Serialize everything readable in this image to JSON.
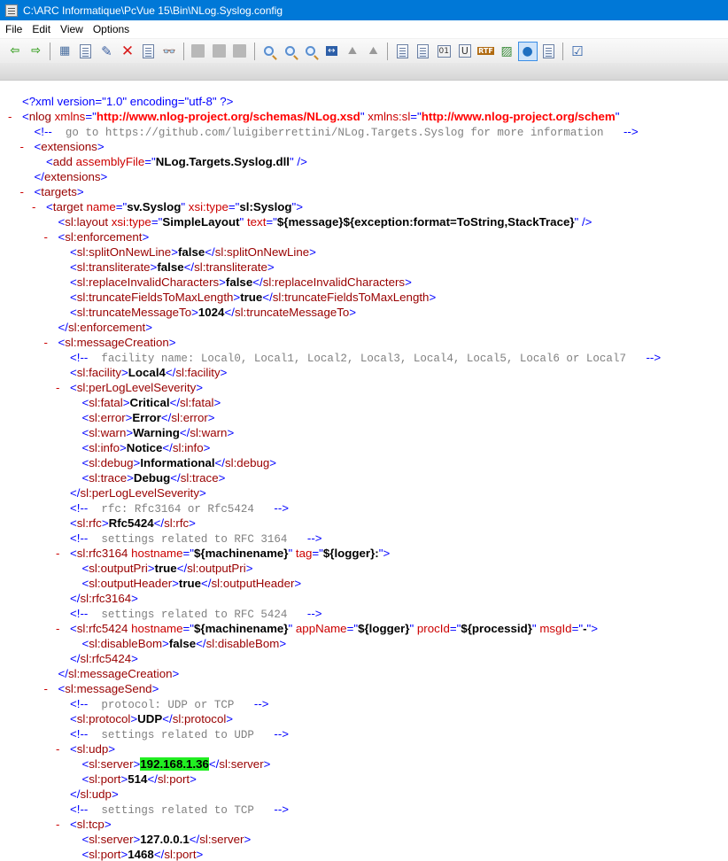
{
  "window": {
    "title": "C:\\ARC Informatique\\PcVue 15\\Bin\\NLog.Syslog.config"
  },
  "menu": [
    "File",
    "Edit",
    "View",
    "Options"
  ],
  "toolbar": {
    "buttons": [
      {
        "name": "back-icon",
        "glyph": "⇦"
      },
      {
        "name": "forward-icon",
        "glyph": "⇨"
      },
      {
        "name": "sep"
      },
      {
        "name": "link-view-icon",
        "glyph": "▦"
      },
      {
        "name": "refresh-icon",
        "glyph": "↻"
      },
      {
        "name": "edit-icon",
        "glyph": "✎"
      },
      {
        "name": "delete-icon",
        "glyph": "✕"
      },
      {
        "name": "validate-icon",
        "glyph": "☑"
      },
      {
        "name": "find-icon",
        "glyph": "🔍"
      },
      {
        "name": "sep"
      },
      {
        "name": "page-icon",
        "glyph": ""
      },
      {
        "name": "page-lines-icon",
        "glyph": ""
      },
      {
        "name": "page-numbered-icon",
        "glyph": ""
      },
      {
        "name": "sep"
      },
      {
        "name": "zoom-in-icon",
        "glyph": ""
      },
      {
        "name": "zoom-out-icon",
        "glyph": ""
      },
      {
        "name": "zoom-icon",
        "glyph": ""
      },
      {
        "name": "fit-width-icon",
        "glyph": "↔"
      },
      {
        "name": "mountain-icon",
        "glyph": "⛰"
      },
      {
        "name": "mountain-alt-icon",
        "glyph": "⛰"
      },
      {
        "name": "sep"
      },
      {
        "name": "text-view-icon",
        "glyph": ""
      },
      {
        "name": "list-view-icon",
        "glyph": ""
      },
      {
        "name": "binary-view-icon",
        "glyph": "01"
      },
      {
        "name": "unicode-view-icon",
        "glyph": "U"
      },
      {
        "name": "rtf-view-icon",
        "glyph": "RTF"
      },
      {
        "name": "image-view-icon",
        "glyph": "▨"
      },
      {
        "name": "web-view-icon",
        "glyph": "●",
        "active": true
      },
      {
        "name": "plugin-view-icon",
        "glyph": ""
      },
      {
        "name": "sep"
      },
      {
        "name": "options-icon",
        "glyph": "☑"
      }
    ]
  },
  "xml": {
    "declaration": "<?xml version=\"1.0\" encoding=\"utf-8\" ?>",
    "nlog_xmlns": "http://www.nlog-project.org/schemas/NLog.xsd",
    "nlog_xmlns_sl": "http://www.nlog-project.org/schem",
    "comment_goto": "go to https://github.com/luigiberrettini/NLog.Targets.Syslog for more information",
    "assemblyFile": "NLog.Targets.Syslog.dll",
    "target_name": "sv.Syslog",
    "target_type": "sl:Syslog",
    "layout_type": "SimpleLayout",
    "layout_text": "${message}${exception:format=ToString,StackTrace}",
    "enforcement": {
      "splitOnNewLine": "false",
      "transliterate": "false",
      "replaceInvalidCharacters": "false",
      "truncateFieldsToMaxLength": "true",
      "truncateMessageTo": "1024"
    },
    "comment_facility": "facility name: Local0, Local1, Local2, Local3, Local4, Local5, Local6 or Local7",
    "facility": "Local4",
    "severity": {
      "fatal": "Critical",
      "error": "Error",
      "warn": "Warning",
      "info": "Notice",
      "debug": "Informational",
      "trace": "Debug"
    },
    "comment_rfc": "rfc: Rfc3164 or Rfc5424",
    "rfc": "Rfc5424",
    "comment_rfc3164": "settings related to RFC 3164",
    "rfc3164_hostname": "${machinename}",
    "rfc3164_tag": "${logger}:",
    "outputPri": "true",
    "outputHeader": "true",
    "comment_rfc5424": "settings related to RFC 5424",
    "rfc5424_hostname": "${machinename}",
    "rfc5424_appName": "${logger}",
    "rfc5424_procId": "${processid}",
    "rfc5424_msgId": "-",
    "disableBom": "false",
    "comment_protocol": "protocol: UDP or TCP",
    "protocol": "UDP",
    "comment_udp": "settings related to UDP",
    "udp_server": "192.168.1.36",
    "udp_port": "514",
    "comment_tcp": "settings related to TCP",
    "tcp_server": "127.0.0.1",
    "tcp_port": "1468"
  },
  "colors": {
    "titlebar": "#0078d7",
    "highlight": "#22ee22",
    "markup": "#0000ff",
    "tag": "#990000",
    "attr": "#cc0000",
    "comment": "#808080"
  }
}
